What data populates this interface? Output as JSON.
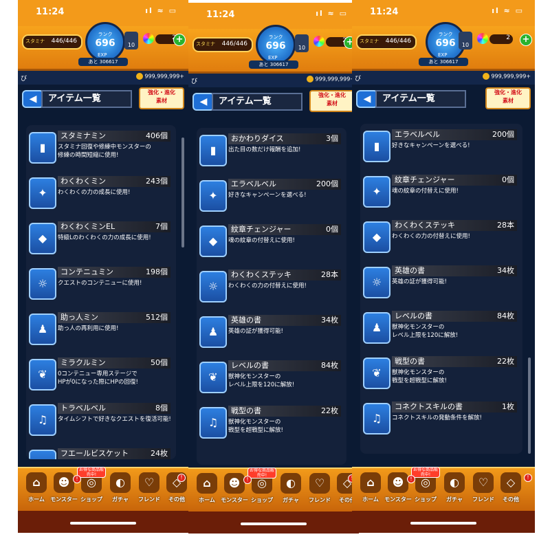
{
  "status": {
    "time": "11:24",
    "sys_icons": "ıl ≈ ▭"
  },
  "hud": {
    "stamina_label": "スタミナ",
    "stamina": "446/446",
    "rank_label": "ランク",
    "rank": "696",
    "exp_label": "EXP",
    "exp_next": "あと 306617",
    "level_box": "10",
    "orbs": "2",
    "coins": "999,999,999+",
    "sub_icon": "び"
  },
  "page": {
    "title": "アイテム一覧",
    "materials_button": "強化・進化\n素材"
  },
  "tabs": [
    {
      "label": "ホーム",
      "icon": "home-icon"
    },
    {
      "label": "モンスター",
      "icon": "monster-icon"
    },
    {
      "label": "ショップ",
      "icon": "shop-icon"
    },
    {
      "label": "ガチャ",
      "icon": "gacha-icon"
    },
    {
      "label": "フレンド",
      "icon": "friend-icon"
    },
    {
      "label": "その他",
      "icon": "other-icon"
    }
  ],
  "shop_badge": "お得な商品販売中!",
  "screens": [
    {
      "items": [
        {
          "name": "スタミナミン",
          "count": "406個",
          "desc": "スタミナ回復や修練中モンスターの\n修練の時間短縮に使用!"
        },
        {
          "name": "わくわくミン",
          "count": "243個",
          "desc": "わくわくの力の成長に使用!"
        },
        {
          "name": "わくわくミンEL",
          "count": "7個",
          "desc": "特級Lのわくわくの力の成長に使用!"
        },
        {
          "name": "コンテニュミン",
          "count": "198個",
          "desc": "クエストのコンテニューに使用!"
        },
        {
          "name": "助っ人ミン",
          "count": "512個",
          "desc": "助っ人の再利用に使用!"
        },
        {
          "name": "ミラクルミン",
          "count": "50個",
          "desc": "0コンテニュー専用ステージで\nHPが0になった際にHPの回復!"
        },
        {
          "name": "トラベルベル",
          "count": "8個",
          "desc": "タイムシフトで好きなクエストを復活可能!"
        },
        {
          "name": "フエールビスケット",
          "count": "24枚",
          "desc": ""
        }
      ]
    },
    {
      "items": [
        {
          "name": "おかわりダイス",
          "count": "3個",
          "desc": "出た目の数だけ報酬を追加!"
        },
        {
          "name": "エラベルベル",
          "count": "200個",
          "desc": "好きなキャンペーンを選べる!"
        },
        {
          "name": "紋章チェンジャー",
          "count": "0個",
          "desc": "魂の紋章の付替えに使用!"
        },
        {
          "name": "わくわくステッキ",
          "count": "28本",
          "desc": "わくわくの力の付替えに使用!"
        },
        {
          "name": "英雄の書",
          "count": "34枚",
          "desc": "英雄の証が獲得可能!"
        },
        {
          "name": "レベルの書",
          "count": "84枚",
          "desc": "獣神化モンスターの\nレベル上限を120に解放!"
        },
        {
          "name": "戦型の書",
          "count": "22枚",
          "desc": "獣神化モンスターの\n戦型を超戦型に解放!"
        }
      ]
    },
    {
      "items": [
        {
          "name": "エラベルベル",
          "count": "200個",
          "desc": "好きなキャンペーンを選べる!"
        },
        {
          "name": "紋章チェンジャー",
          "count": "0個",
          "desc": "魂の紋章の付替えに使用!"
        },
        {
          "name": "わくわくステッキ",
          "count": "28本",
          "desc": "わくわくの力の付替えに使用!"
        },
        {
          "name": "英雄の書",
          "count": "34枚",
          "desc": "英雄の証が獲得可能!"
        },
        {
          "name": "レベルの書",
          "count": "84枚",
          "desc": "獣神化モンスターの\nレベル上限を120に解放!"
        },
        {
          "name": "戦型の書",
          "count": "22枚",
          "desc": "獣神化モンスターの\n戦型を超戦型に解放!"
        },
        {
          "name": "コネクトスキルの書",
          "count": "1枚",
          "desc": "コネクトスキルの発動条件を解放!"
        }
      ]
    }
  ]
}
